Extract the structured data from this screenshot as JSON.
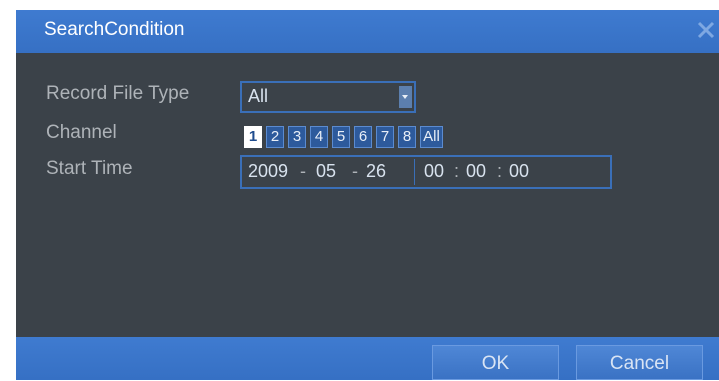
{
  "dialog": {
    "title": "SearchCondition",
    "close_icon": "close-icon"
  },
  "form": {
    "record_file_type": {
      "label": "Record File Type",
      "value": "All"
    },
    "channel": {
      "label": "Channel",
      "options": [
        "1",
        "2",
        "3",
        "4",
        "5",
        "6",
        "7",
        "8",
        "All"
      ],
      "selected": "1"
    },
    "start_time": {
      "label": "Start Time",
      "year": "2009",
      "month": "05",
      "day": "26",
      "hour": "00",
      "minute": "00",
      "second": "00"
    }
  },
  "footer": {
    "ok_label": "OK",
    "cancel_label": "Cancel"
  },
  "colors": {
    "title_bar": "#3670c4",
    "panel": "#3b4249",
    "field_border": "#3a6fb8"
  }
}
